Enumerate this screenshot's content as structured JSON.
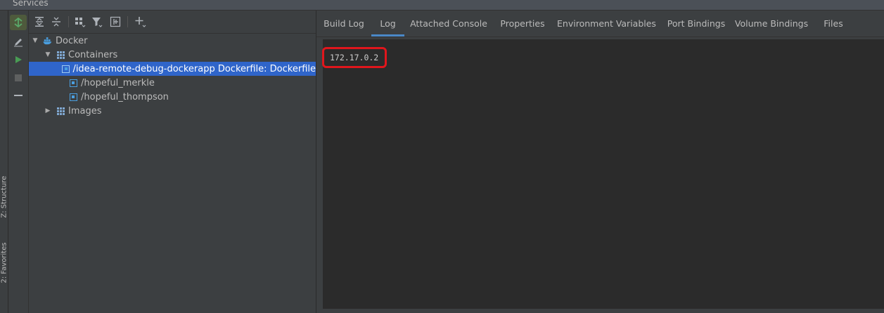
{
  "window": {
    "title": "Services"
  },
  "left_stripe": {
    "items": [
      "Z: Structure",
      "2: Favorites"
    ]
  },
  "action_bar": {
    "buttons": [
      {
        "name": "deploy-icon"
      },
      {
        "name": "edit-icon"
      },
      {
        "name": "run-icon"
      },
      {
        "name": "stop-icon"
      },
      {
        "name": "collapse-icon"
      }
    ]
  },
  "tree_toolbar": {
    "buttons": [
      {
        "name": "expand-all-icon"
      },
      {
        "name": "collapse-all-icon"
      },
      {
        "name": "group-by-icon"
      },
      {
        "name": "filter-icon"
      },
      {
        "name": "add-service-icon"
      },
      {
        "name": "add-icon"
      }
    ]
  },
  "tree": {
    "root": {
      "label": "Docker"
    },
    "containers": {
      "label": "Containers",
      "items": [
        {
          "label": "/idea-remote-debug-dockerapp Dockerfile: Dockerfile",
          "selected": true
        },
        {
          "label": "/hopeful_merkle",
          "selected": false
        },
        {
          "label": "/hopeful_thompson",
          "selected": false
        }
      ]
    },
    "images": {
      "label": "Images"
    }
  },
  "tabs": [
    {
      "label": "Build Log",
      "active": false
    },
    {
      "label": "Log",
      "active": true
    },
    {
      "label": "Attached Console",
      "active": false
    },
    {
      "label": "Properties",
      "active": false
    },
    {
      "label": "Environment Variables",
      "active": false
    },
    {
      "label": "Port Bindings",
      "active": false
    },
    {
      "label": "Volume Bindings",
      "active": false
    },
    {
      "label": "Files",
      "active": false
    }
  ],
  "log": {
    "text": "172.17.0.2"
  },
  "colors": {
    "background": "#3c3f41",
    "log_background": "#2b2b2b",
    "selection": "#2f65ca",
    "tab_underline": "#4a88c7",
    "highlight_border": "#e0161c"
  }
}
